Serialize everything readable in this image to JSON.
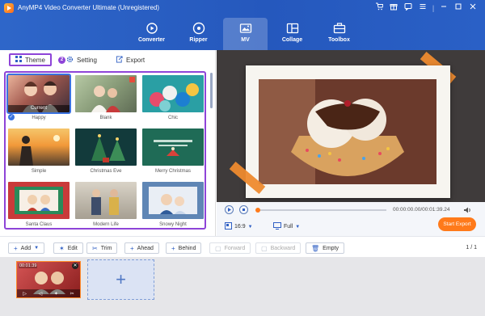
{
  "app": {
    "title": "AnyMP4 Video Converter Ultimate (Unregistered)"
  },
  "window_controls": [
    "cart-icon",
    "gift-icon",
    "chat-icon",
    "menu-icon",
    "minimize-icon",
    "maximize-icon",
    "close-icon"
  ],
  "nav": {
    "tabs": [
      {
        "label": "Converter",
        "icon": "converter-icon"
      },
      {
        "label": "Ripper",
        "icon": "ripper-icon"
      },
      {
        "label": "MV",
        "icon": "mv-icon",
        "active": true
      },
      {
        "label": "Collage",
        "icon": "collage-icon"
      },
      {
        "label": "Toolbox",
        "icon": "toolbox-icon"
      }
    ]
  },
  "subtabs": {
    "theme": "Theme",
    "step": "2",
    "setting": "Setting",
    "export": "Export"
  },
  "themes": [
    {
      "label": "Happy",
      "selected": true,
      "current": "Current"
    },
    {
      "label": "Blank"
    },
    {
      "label": "Chic"
    },
    {
      "label": "Simple"
    },
    {
      "label": "Christmas Eve"
    },
    {
      "label": "Merry Christmas"
    },
    {
      "label": "Santa Claus"
    },
    {
      "label": "Modern Life"
    },
    {
      "label": "Snowy Night"
    }
  ],
  "player": {
    "timecode": "00:00:00.00/00:01:39.24",
    "progress": 0,
    "aspect_ratio": "16:9",
    "display_mode": "Full",
    "start_export": "Start Export"
  },
  "toolbar": {
    "add": "Add",
    "edit": "Edit",
    "trim": "Trim",
    "ahead": "Ahead",
    "behind": "Behind",
    "forward": "Forward",
    "backward": "Backward",
    "empty": "Empty",
    "page": "1 / 1"
  },
  "timeline": {
    "clip_time": "00:01:39",
    "add_symbol": "+"
  },
  "colors": {
    "accent_blue": "#2558bd",
    "highlight_purple": "#8e44d8",
    "export_orange": "#ff7a1a"
  }
}
